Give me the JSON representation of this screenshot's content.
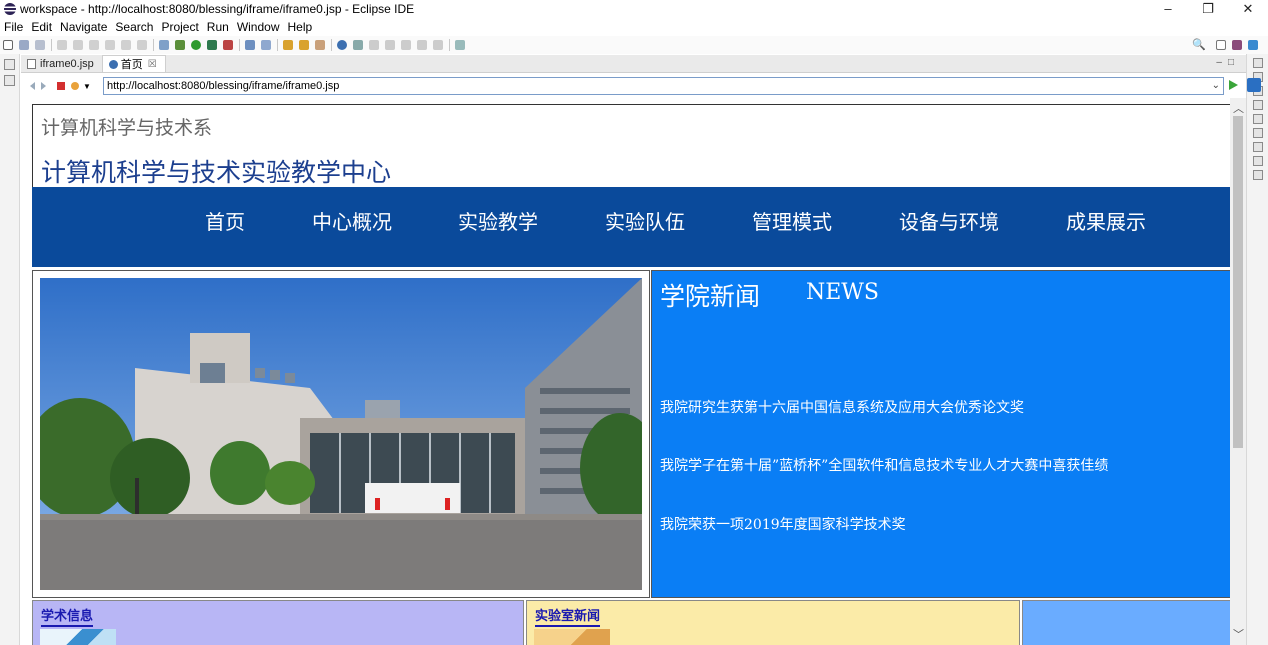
{
  "window": {
    "title": "workspace - http://localhost:8080/blessing/iframe/iframe0.jsp - Eclipse IDE",
    "controls": [
      "–",
      "❐",
      "✕"
    ]
  },
  "menu": [
    "File",
    "Edit",
    "Navigate",
    "Search",
    "Project",
    "Run",
    "Window",
    "Help"
  ],
  "tabs": [
    {
      "label": "iframe0.jsp",
      "active": false,
      "icon": "jsp-file-icon"
    },
    {
      "label": "首页",
      "active": true,
      "icon": "globe-icon",
      "close": "☒"
    }
  ],
  "browser": {
    "url": "http://localhost:8080/blessing/iframe/iframe0.jsp"
  },
  "site": {
    "dept": "计算机科学与技术系",
    "center_title": "计算机科学与技术实验教学中心",
    "nav": [
      "首页",
      "中心概况",
      "实验教学",
      "实验队伍",
      "管理模式",
      "设备与环境",
      "成果展示"
    ],
    "news_title": "学院新闻",
    "news_sub": "NEWS",
    "news_items": [
      "我院研究生获第十六届中国信息系统及应用大会优秀论文奖",
      "我院学子在第十届”蓝桥杯”全国软件和信息技术专业人才大赛中喜获佳绩",
      "我院荣获一项2019年度国家科学技术奖"
    ],
    "boxes": [
      {
        "label": "学术信息",
        "bg": "#b8b6f5"
      },
      {
        "label": "实验室新闻",
        "bg": "#fbeba8"
      },
      {
        "label": "",
        "bg": "#6aacff"
      }
    ]
  },
  "colors": {
    "nav_bg": "#0a4a9b",
    "news_bg": "#0a7ef5",
    "title_blue": "#1c3f8f"
  }
}
